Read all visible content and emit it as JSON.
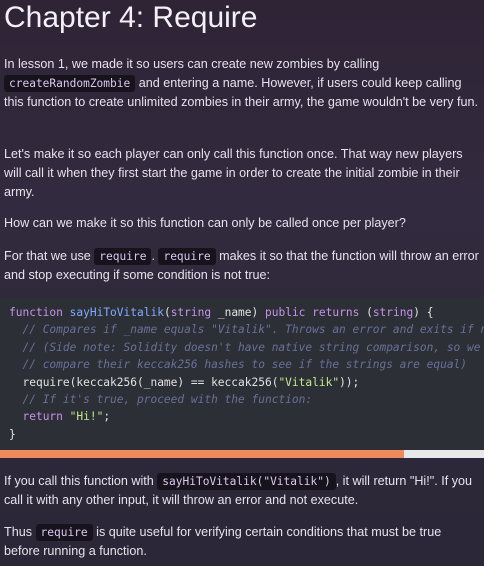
{
  "title": "Chapter 4: Require",
  "para1": {
    "t1": "In lesson 1, we made it so users can create new zombies by calling ",
    "code": "createRandomZombie",
    "t2": " and entering a name. However, if users could keep calling this function to create unlimited zombies in their army, the game wouldn't be very fun."
  },
  "para2": "Let's make it so each player can only call this function once. That way new players will call it when they first start the game in order to create the initial zombie in their army.",
  "para3": "How can we make it so this function can only be called once per player?",
  "para4": {
    "t1": "For that we use ",
    "code1": "require",
    "t2": ". ",
    "code2": "require",
    "t3": " makes it so that the function will throw an error and stop executing if some condition is not true:"
  },
  "code": {
    "l1": {
      "kw1": "function",
      "fn": "sayHiToVitalik",
      "p1": "(",
      "ty1": "string",
      "p2": " _name) ",
      "kw2": "public",
      "p3": " ",
      "kw3": "returns",
      "p4": " (",
      "ty2": "string",
      "p5": ") {"
    },
    "l2": "// Compares if _name equals \"Vitalik\". Throws an error and exits if not true.",
    "l3": "// (Side note: Solidity doesn't have native string comparison, so we",
    "l4": "// compare their keccak256 hashes to see if the strings are equal)",
    "l5": {
      "p1": "require(keccak256(_name) == keccak256(",
      "str": "\"Vitalik\"",
      "p2": "));"
    },
    "l6": "// If it's true, proceed with the function:",
    "l7": {
      "kw": "return",
      "p1": " ",
      "str": "\"Hi!\"",
      "p2": ";"
    },
    "l8": "}"
  },
  "scroll_position": 0.835,
  "para5": {
    "t1": "If you call this function with ",
    "code": "sayHiToVitalik(\"Vitalik\")",
    "t2": ", it will return \"Hi!\". If you call it with any other input, it will throw an error and not execute."
  },
  "para6": {
    "t1": "Thus ",
    "code": "require",
    "t2": " is quite useful for verifying certain conditions that must be true before running a function."
  },
  "colors": {
    "background": "#2f2436",
    "code_background": "#2d2f36",
    "scroll_thumb": "#ef8a5c",
    "scroll_track": "#e8e8e8"
  }
}
